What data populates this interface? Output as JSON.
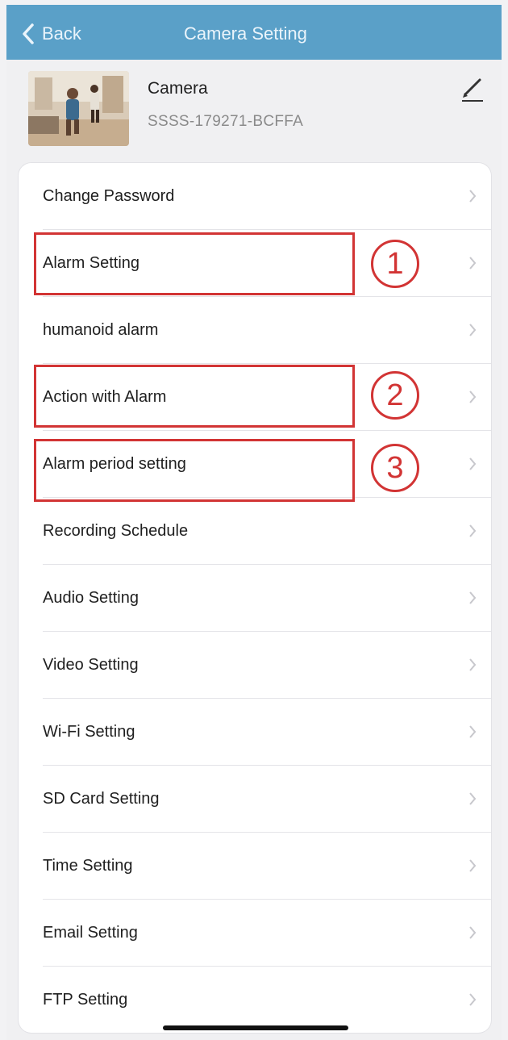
{
  "nav": {
    "back_label": "Back",
    "title": "Camera Setting"
  },
  "device": {
    "name": "Camera",
    "id": "SSSS-179271-BCFFA"
  },
  "menu": [
    {
      "label": "Change Password"
    },
    {
      "label": "Alarm Setting"
    },
    {
      "label": "humanoid alarm"
    },
    {
      "label": "Action with Alarm"
    },
    {
      "label": "Alarm period setting"
    },
    {
      "label": "Recording Schedule"
    },
    {
      "label": "Audio Setting"
    },
    {
      "label": "Video Setting"
    },
    {
      "label": "Wi-Fi Setting"
    },
    {
      "label": "SD Card Setting"
    },
    {
      "label": "Time Setting"
    },
    {
      "label": "Email Setting"
    },
    {
      "label": "FTP Setting"
    }
  ],
  "annotations": [
    {
      "number": "1",
      "target": "Alarm Setting"
    },
    {
      "number": "2",
      "target": "Action with Alarm"
    },
    {
      "number": "3",
      "target": "Alarm period setting"
    }
  ],
  "colors": {
    "navbar": "#5aa0c8",
    "annotation": "#d23434"
  },
  "icons": [
    "chevron-left-icon",
    "pencil-icon",
    "chevron-right-icon"
  ]
}
